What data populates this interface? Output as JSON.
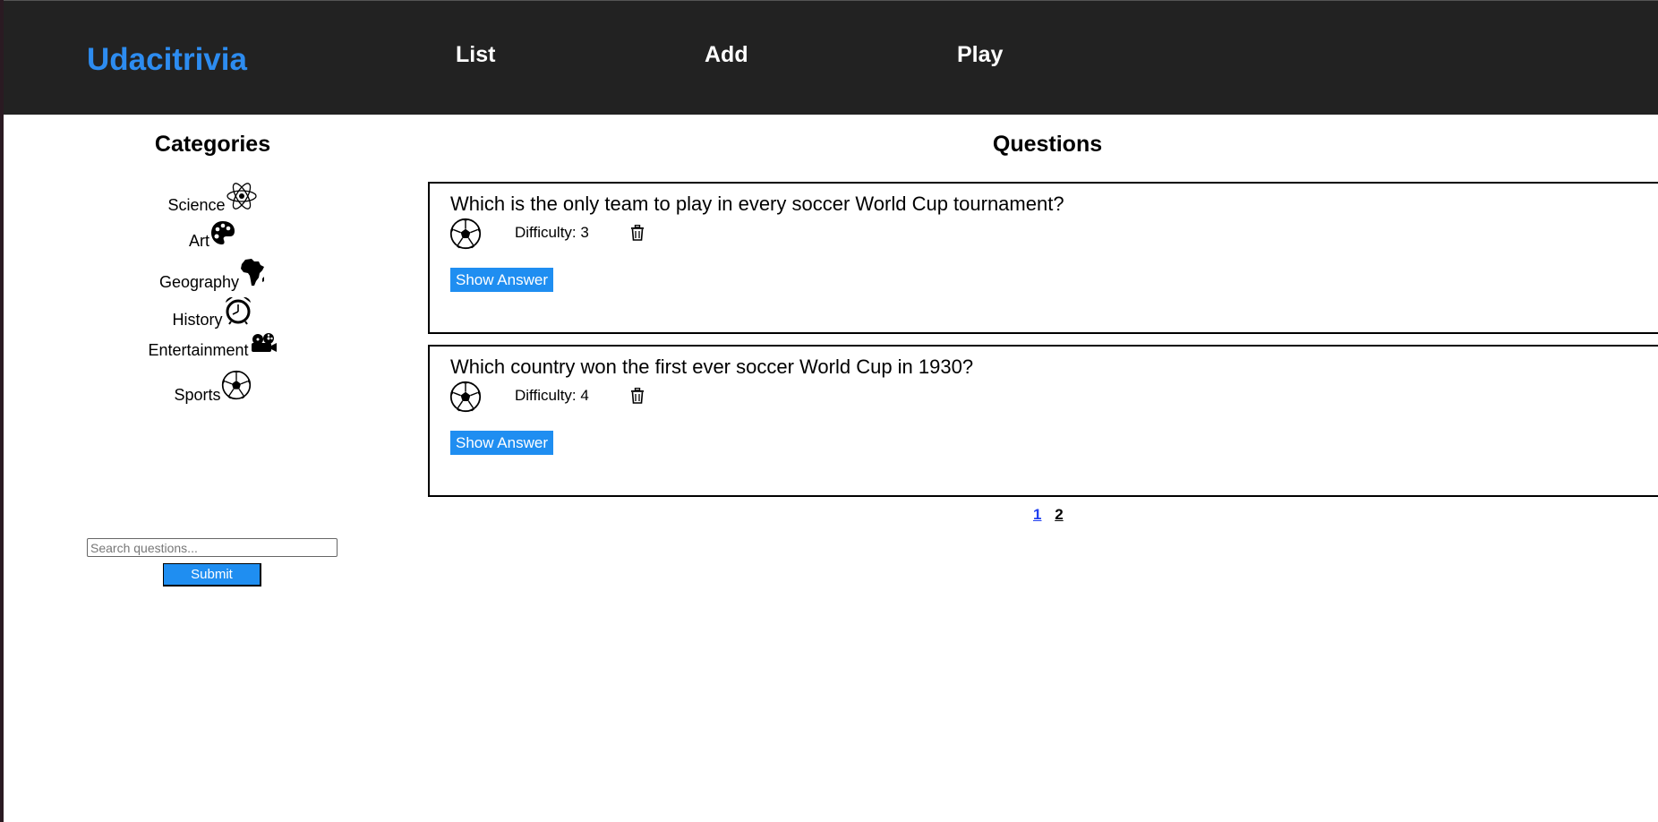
{
  "header": {
    "brand": "Udacitrivia",
    "nav": [
      {
        "label": "List"
      },
      {
        "label": "Add"
      },
      {
        "label": "Play"
      }
    ],
    "background_color": "#222222",
    "brand_color": "#2d8cf0"
  },
  "sidebar": {
    "title": "Categories",
    "categories": [
      {
        "label": "Science",
        "icon": "atom-icon"
      },
      {
        "label": "Art",
        "icon": "palette-icon"
      },
      {
        "label": "Geography",
        "icon": "africa-map-icon"
      },
      {
        "label": "History",
        "icon": "alarm-clock-icon"
      },
      {
        "label": "Entertainment",
        "icon": "film-projector-icon"
      },
      {
        "label": "Sports",
        "icon": "soccer-ball-icon"
      }
    ],
    "search": {
      "placeholder": "Search questions...",
      "value": ""
    },
    "submit_label": "Submit"
  },
  "main": {
    "title": "Questions",
    "questions": [
      {
        "text": "Which is the only team to play in every soccer World Cup tournament?",
        "category_icon": "soccer-ball-icon",
        "difficulty": "Difficulty: 3",
        "show_answer_label": "Show Answer"
      },
      {
        "text": "Which country won the first ever soccer World Cup in 1930?",
        "category_icon": "soccer-ball-icon",
        "difficulty": "Difficulty: 4",
        "show_answer_label": "Show Answer"
      }
    ],
    "pagination": {
      "pages": [
        "1",
        "2"
      ],
      "current": "1"
    }
  },
  "colors": {
    "accent": "#1f8ef1",
    "active_page": "#1f3ff0"
  }
}
